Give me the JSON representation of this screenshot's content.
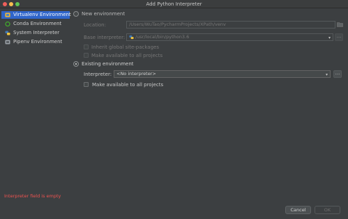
{
  "window": {
    "title": "Add Python Interpreter"
  },
  "sidebar": {
    "items": [
      {
        "label": "Virtualenv Environment",
        "icon": "virtualenv-icon",
        "selected": true
      },
      {
        "label": "Conda Environment",
        "icon": "conda-icon",
        "selected": false
      },
      {
        "label": "System Interpreter",
        "icon": "python-icon",
        "selected": false
      },
      {
        "label": "Pipenv Environment",
        "icon": "pipenv-icon",
        "selected": false
      }
    ]
  },
  "new_env": {
    "radio_label": "New environment",
    "selected": false,
    "location_label": "Location:",
    "location_value": "/Users/WuTao/PycharmProjects/XPath/venv",
    "base_label": "Base interpreter:",
    "base_value": "/usr/local/bin/python3.6",
    "inherit_label": "Inherit global site-packages",
    "make_available_label": "Make available to all projects"
  },
  "existing_env": {
    "radio_label": "Existing environment",
    "selected": true,
    "interpreter_label": "Interpreter:",
    "interpreter_value": "<No interpreter>",
    "make_available_label": "Make available to all projects"
  },
  "browse_label": "...",
  "error_text": "Interpreter field is empty",
  "buttons": {
    "cancel": "Cancel",
    "ok": "OK"
  },
  "colors": {
    "selection": "#2f65ca",
    "error": "#ef5350",
    "background": "#3c3f41"
  }
}
